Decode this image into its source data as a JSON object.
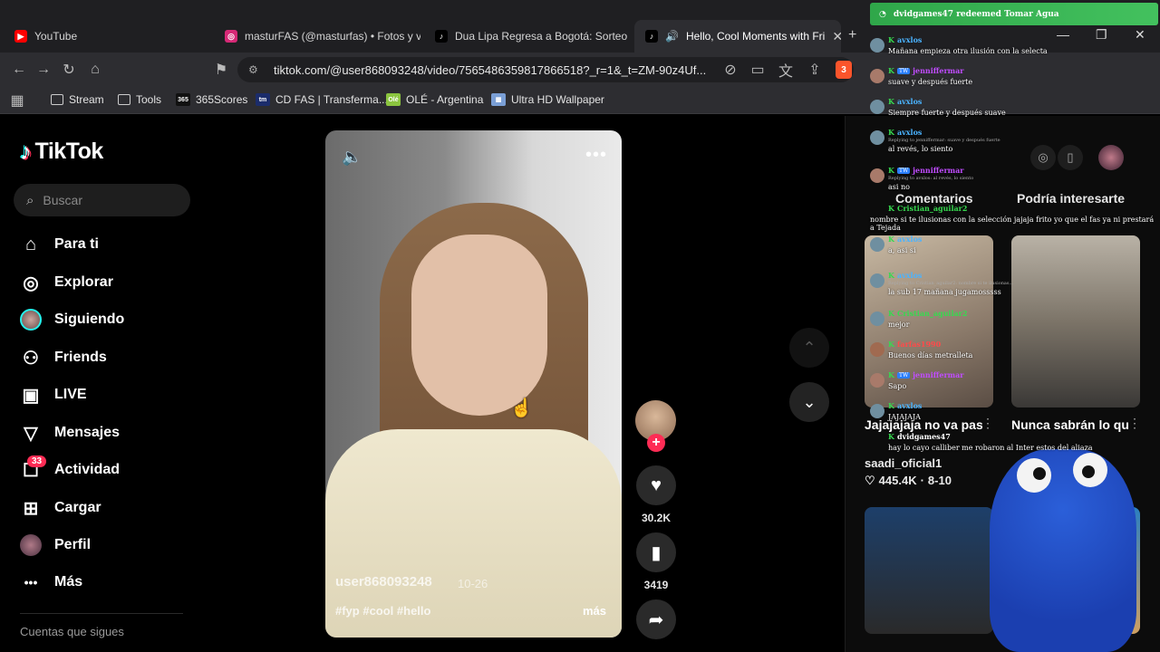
{
  "browser": {
    "tabs": [
      {
        "title": "YouTube",
        "favicon_color": "#ff0000",
        "favicon_glyph": "▶"
      },
      {
        "title": "masturFAS (@masturfas) • Fotos y vid",
        "favicon_color": "#d62976",
        "favicon_glyph": "◎"
      },
      {
        "title": "Dua Lipa Regresa a Bogotá: Sorteo d",
        "favicon_color": "#000000",
        "favicon_glyph": "♪"
      },
      {
        "title": "Hello, Cool Moments with Fri",
        "favicon_color": "#000000",
        "favicon_glyph": "♪"
      }
    ],
    "url": "tiktok.com/@user868093248/video/7565486359817866518?_r=1&_t=ZM-90z4Uf...",
    "bookmarks": [
      {
        "label": "Stream",
        "type": "folder"
      },
      {
        "label": "Tools",
        "type": "folder"
      },
      {
        "label": "365Scores",
        "type": "logo",
        "color": "#111111",
        "logo": "365"
      },
      {
        "label": "CD FAS | Transferma...",
        "type": "logo",
        "color": "#1b2c6b",
        "logo": "tm"
      },
      {
        "label": "OLÉ - Argentina",
        "type": "logo",
        "color": "#8bc53f",
        "logo": "Olé"
      },
      {
        "label": "Ultra HD Wallpaper",
        "type": "logo",
        "color": "#7a9fd6",
        "logo": "▦"
      }
    ],
    "brave_badge": "3"
  },
  "tiktok": {
    "logo_text": "TikTok",
    "search_placeholder": "Buscar",
    "nav": [
      {
        "label": "Para ti",
        "icon": "home-icon"
      },
      {
        "label": "Explorar",
        "icon": "compass-icon"
      },
      {
        "label": "Siguiendo",
        "icon": "avatar-icon"
      },
      {
        "label": "Friends",
        "icon": "friends-icon"
      },
      {
        "label": "LIVE",
        "icon": "live-icon"
      },
      {
        "label": "Mensajes",
        "icon": "messages-icon"
      },
      {
        "label": "Actividad",
        "icon": "activity-icon"
      },
      {
        "label": "Cargar",
        "icon": "upload-icon"
      },
      {
        "label": "Perfil",
        "icon": "profile-icon"
      },
      {
        "label": "Más",
        "icon": "more-icon"
      }
    ],
    "activity_badge": "33",
    "following_footer": "Cuentas que sigues",
    "video": {
      "author": "user868093248",
      "date": "10-26",
      "tags": "#fyp #cool #hello",
      "more": "más"
    },
    "actions": {
      "likes": "30.2K",
      "saves": "3419"
    },
    "right_tabs": [
      "Comentarios",
      "Podría interesarte"
    ],
    "recommendations": [
      {
        "title": "Jajajajaja no va pasar nada pero...",
        "author": "saadi_oficial1",
        "likes": "445.4K",
        "date": "8-10"
      },
      {
        "title": "Nunca sabrán lo que yo viendo...",
        "author": "",
        "likes": "",
        "date": ""
      }
    ]
  },
  "chat": {
    "alert": "dvidgames47 redeemed Tomar Agua",
    "messages": [
      {
        "user": "avxlos",
        "text": "Mañana empieza otra ilusión con la selecta",
        "color": "#4ab3ff"
      },
      {
        "user": "jenniffermar",
        "text": "suave y después fuerte",
        "color": "#c04cff"
      },
      {
        "user": "avxlos",
        "text": "Siempre fuerte y después suave",
        "color": "#4ab3ff"
      },
      {
        "user": "avxlos",
        "text": "al revés, lo siento",
        "color": "#4ab3ff",
        "reply": "Replying to jenniffermar: suave y después fuerte"
      },
      {
        "user": "jenniffermar",
        "text": "asi no",
        "color": "#c04cff",
        "reply": "Replying to avxlos: al revés, lo siento"
      },
      {
        "user": "Cristian_aguilar2",
        "text": "nombre si te ilusionas con la selección jajaja frito yo que el fas ya ni prestará a Tejada",
        "color": "#37d94f"
      },
      {
        "user": "avxlos",
        "text": "a, asi si",
        "color": "#4ab3ff"
      },
      {
        "user": "avxlos",
        "text": "la sub 17 mañana jugamosssss",
        "color": "#4ab3ff",
        "reply": "Replying to Cristian_aguilar2: nombre si te ilusionas..."
      },
      {
        "user": "Cristian_aguilar2",
        "text": "mejor",
        "color": "#37d94f"
      },
      {
        "user": "farfas1990",
        "text": "Buenos días metralleta",
        "color": "#ff4a4a"
      },
      {
        "user": "jenniffermar",
        "text": "Sapo",
        "color": "#c04cff"
      },
      {
        "user": "avxlos",
        "text": "JAJAJAJA",
        "color": "#4ab3ff"
      },
      {
        "user": "dvidgames47",
        "text": "hay lo cayo calliber me robaron al Inter estos del aliaza",
        "color": "#ffffff"
      }
    ]
  }
}
